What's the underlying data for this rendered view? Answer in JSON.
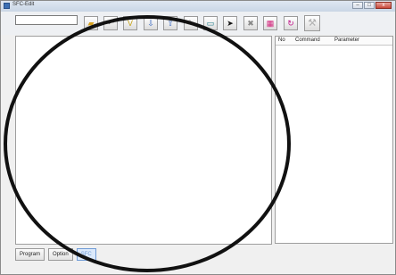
{
  "window": {
    "title": "SFC-Edit",
    "minimize": "–",
    "maximize": "□",
    "close": "x"
  },
  "toolbar": {
    "combo_value": "",
    "buttons": [
      {
        "icon": "folder-open-icon",
        "glyph": "▰",
        "color": "#d8a21f"
      },
      {
        "icon": "undo-icon",
        "glyph": "↶",
        "color": "#7a7a7a"
      },
      {
        "icon": "redo-icon",
        "glyph": "V",
        "color": "#c6a317"
      },
      {
        "icon": "move-down-icon",
        "glyph": "⇩",
        "color": "#3a6ac2"
      },
      {
        "icon": "move-up-icon",
        "glyph": "⇧",
        "color": "#3a6ac2"
      },
      {
        "icon": "edit-icon",
        "glyph": "✎",
        "color": "#7a7a7a"
      },
      {
        "icon": "window-icon",
        "glyph": "▭",
        "color": "#1d7c8a"
      },
      {
        "icon": "pointer-icon",
        "glyph": "➤",
        "color": "#111111"
      },
      {
        "icon": "delete-icon",
        "glyph": "✖",
        "color": "#888888"
      },
      {
        "icon": "grid-icon",
        "glyph": "▦",
        "color": "#d2207a"
      },
      {
        "icon": "loop-icon",
        "glyph": "↻",
        "color": "#c0148a"
      },
      {
        "icon": "settings-wrench-icon",
        "glyph": "⚒",
        "color": "#b0b0b0"
      }
    ]
  },
  "command_grid": {
    "headers": [
      "No",
      "Command",
      "Parameter"
    ]
  },
  "tabs": [
    {
      "label": "Program",
      "selected": false
    },
    {
      "label": "Option",
      "selected": false
    },
    {
      "label": "SFC",
      "selected": true
    }
  ],
  "colors": {
    "annotation_ellipse": "#111111"
  }
}
